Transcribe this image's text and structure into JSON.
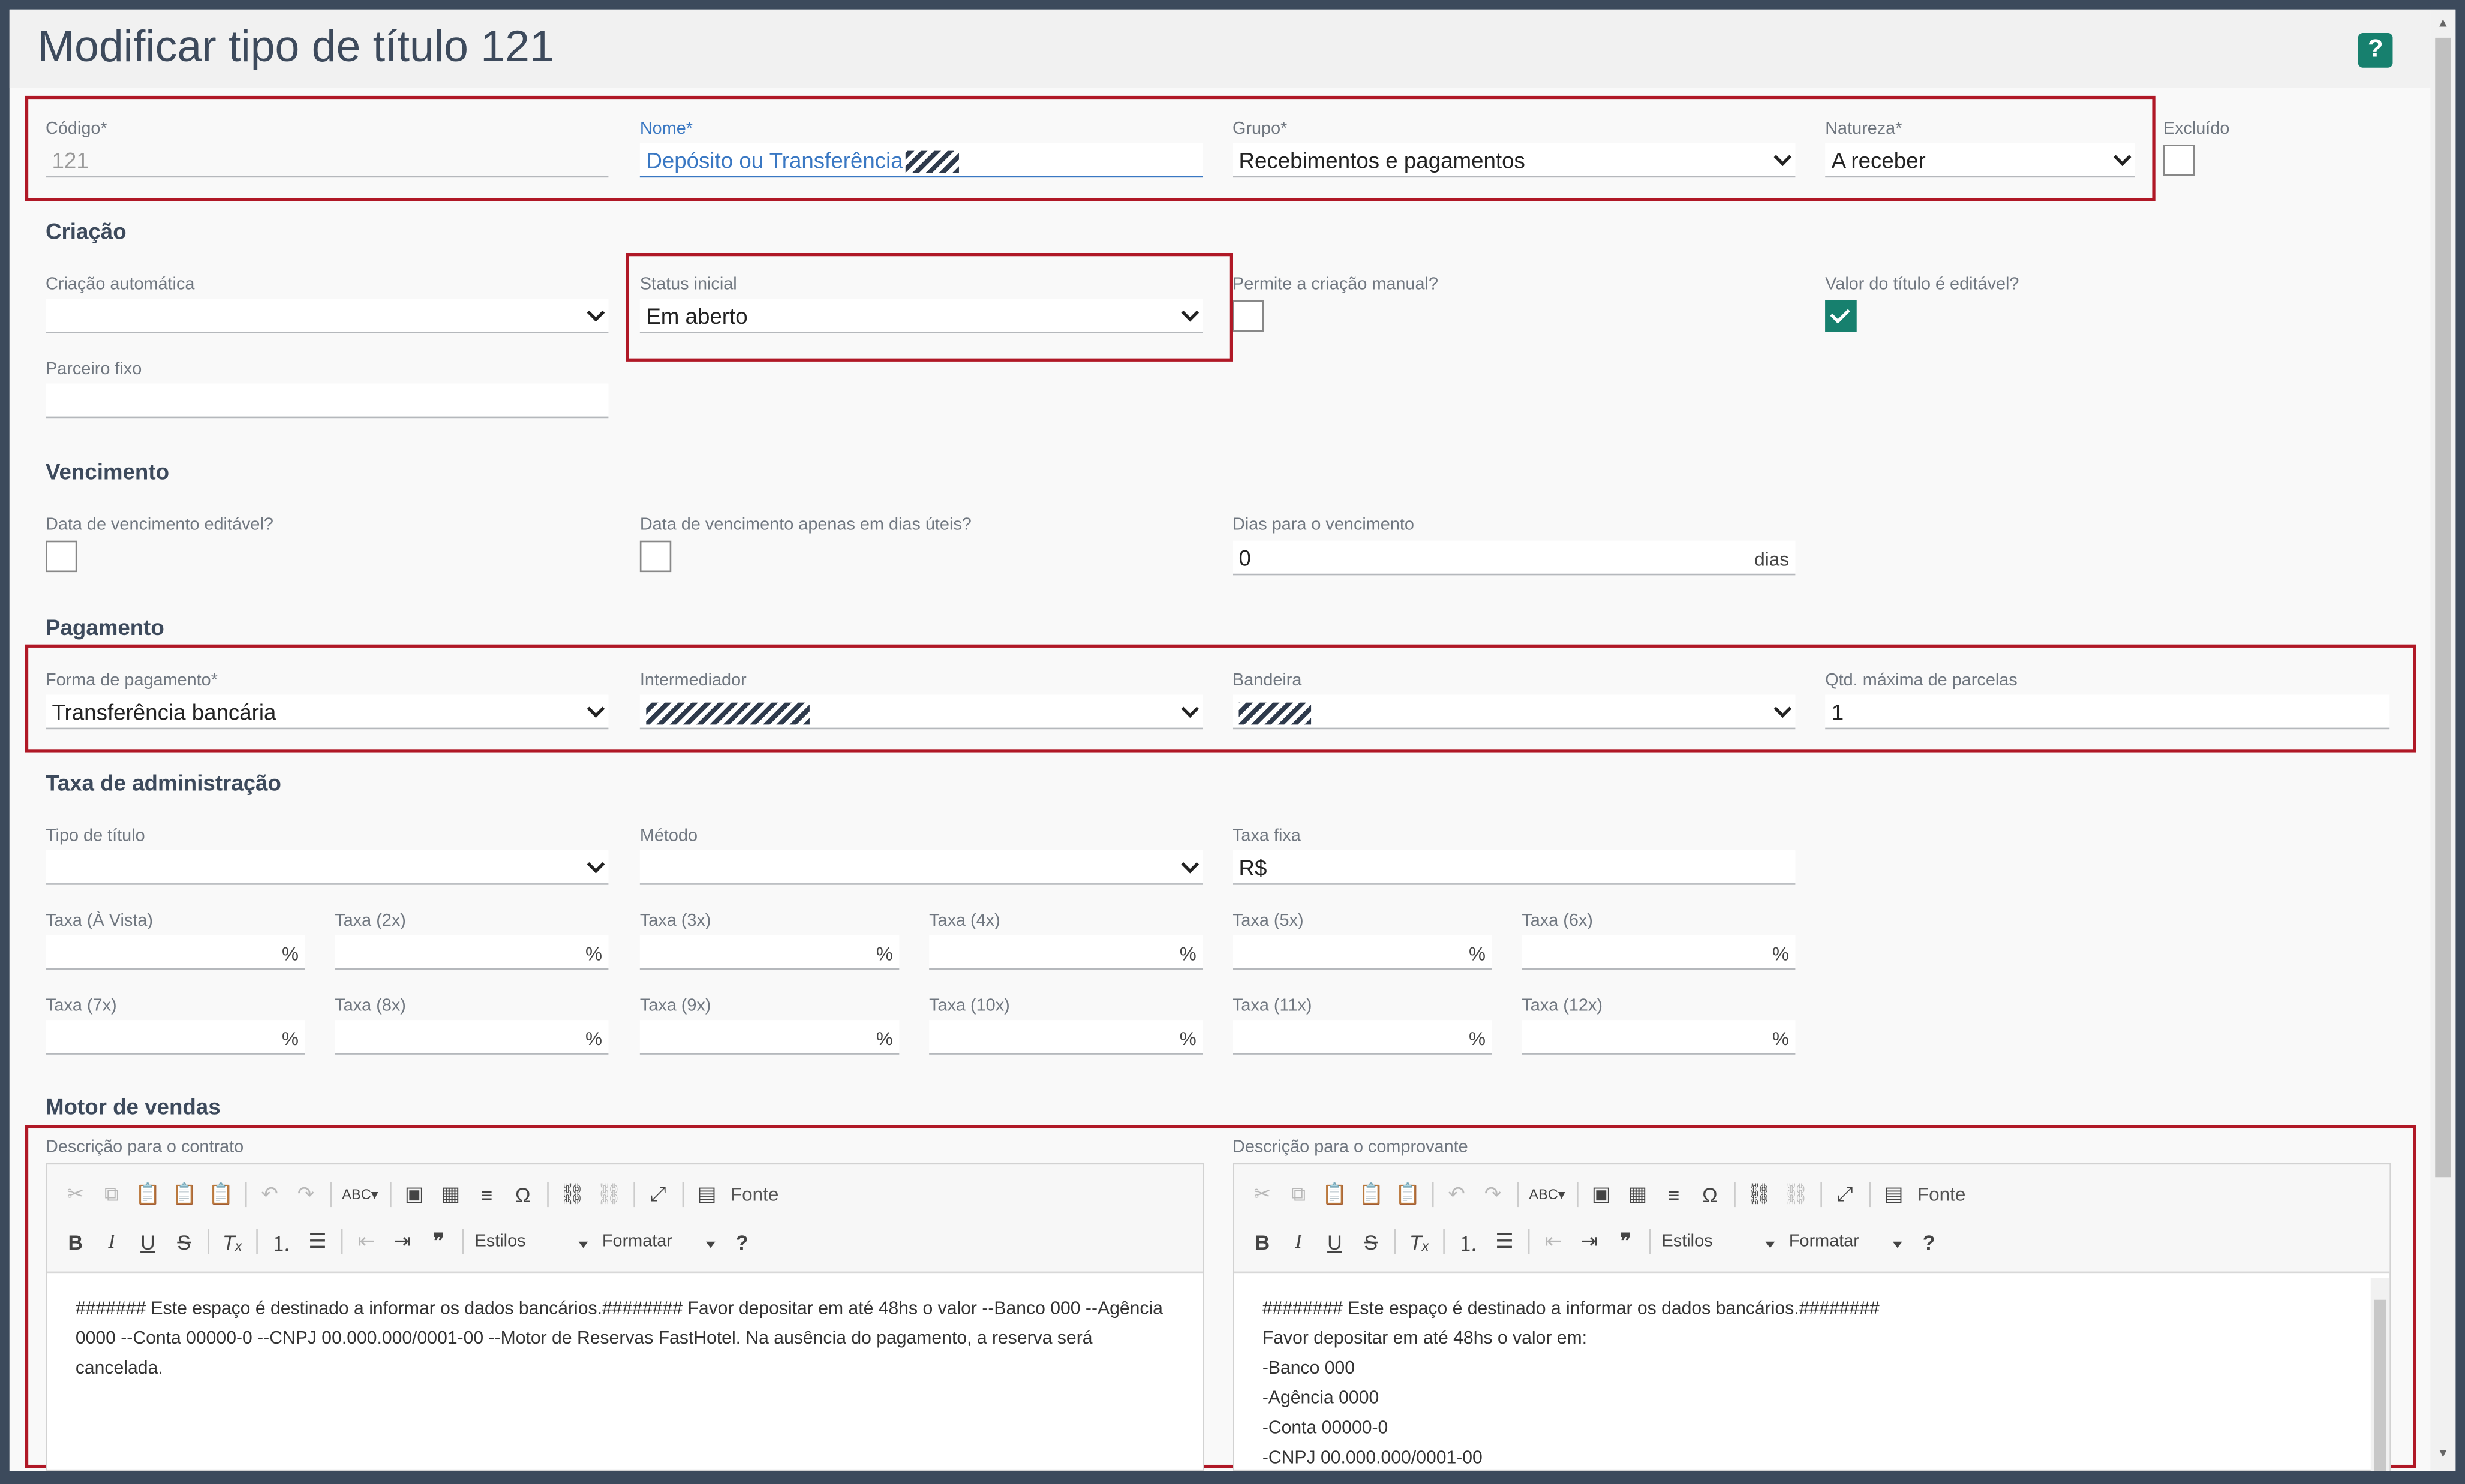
{
  "page": {
    "title": "Modificar tipo de título 121",
    "help_icon": "?"
  },
  "ident": {
    "codigo": {
      "label": "Código*",
      "value": "121"
    },
    "nome": {
      "label": "Nome*",
      "value": "Depósito ou Transferência"
    },
    "grupo": {
      "label": "Grupo*",
      "value": "Recebimentos e pagamentos"
    },
    "natureza": {
      "label": "Natureza*",
      "value": "A receber"
    },
    "excluido": {
      "label": "Excluído",
      "checked": false
    }
  },
  "criacao": {
    "section": "Criação",
    "criacao_automatica": {
      "label": "Criação automática",
      "value": ""
    },
    "status_inicial": {
      "label": "Status inicial",
      "value": "Em aberto"
    },
    "permite_manual": {
      "label": "Permite a criação manual?",
      "checked": false
    },
    "valor_editavel": {
      "label": "Valor do título é editável?",
      "checked": true
    },
    "parceiro_fixo": {
      "label": "Parceiro fixo",
      "value": ""
    }
  },
  "vencimento": {
    "section": "Vencimento",
    "data_editavel": {
      "label": "Data de vencimento editável?",
      "checked": false
    },
    "dias_uteis": {
      "label": "Data de vencimento apenas em dias úteis?",
      "checked": false
    },
    "dias": {
      "label": "Dias para o vencimento",
      "value": "0",
      "unit": "dias"
    }
  },
  "pagamento": {
    "section": "Pagamento",
    "forma": {
      "label": "Forma de pagamento*",
      "value": "Transferência bancária"
    },
    "intermediador": {
      "label": "Intermediador",
      "value": ""
    },
    "bandeira": {
      "label": "Bandeira",
      "value": ""
    },
    "parcelas": {
      "label": "Qtd. máxima de parcelas",
      "value": "1"
    }
  },
  "taxa": {
    "section": "Taxa de administração",
    "tipo_titulo": {
      "label": "Tipo de título",
      "value": ""
    },
    "metodo": {
      "label": "Método",
      "value": ""
    },
    "taxa_fixa": {
      "label": "Taxa fixa",
      "value": "R$"
    },
    "percent_unit": "%",
    "rates": [
      {
        "label": "Taxa (À Vista)",
        "value": ""
      },
      {
        "label": "Taxa (2x)",
        "value": ""
      },
      {
        "label": "Taxa (3x)",
        "value": ""
      },
      {
        "label": "Taxa (4x)",
        "value": ""
      },
      {
        "label": "Taxa (5x)",
        "value": ""
      },
      {
        "label": "Taxa (6x)",
        "value": ""
      },
      {
        "label": "Taxa (7x)",
        "value": ""
      },
      {
        "label": "Taxa (8x)",
        "value": ""
      },
      {
        "label": "Taxa (9x)",
        "value": ""
      },
      {
        "label": "Taxa (10x)",
        "value": ""
      },
      {
        "label": "Taxa (11x)",
        "value": ""
      },
      {
        "label": "Taxa (12x)",
        "value": ""
      }
    ]
  },
  "motor": {
    "section": "Motor de vendas",
    "toolbar": {
      "fonte": "Fonte",
      "estilos": "Estilos",
      "formatar": "Formatar"
    },
    "contrato": {
      "label": "Descrição para o contrato",
      "text": "####### Este espaço é destinado a informar os dados bancários.######## Favor depositar em até 48hs o valor --Banco 000 --Agência 0000 --Conta 00000-0 --CNPJ 00.000.000/0001-00 --Motor de Reservas FastHotel. Na ausência do pagamento, a reserva será cancelada."
    },
    "comprovante": {
      "label": "Descrição para o comprovante",
      "lines": [
        "######## Este espaço é destinado a informar os dados bancários.########",
        "Favor depositar em até 48hs o valor em:",
        "-Banco 000",
        "-Agência 0000",
        "-Conta 00000-0",
        "-CNPJ 00.000.000/0001-00"
      ]
    }
  },
  "colors": {
    "accent": "#17806e",
    "highlight": "#b01826",
    "title": "#3d4a5c",
    "link": "#3a78c3"
  }
}
